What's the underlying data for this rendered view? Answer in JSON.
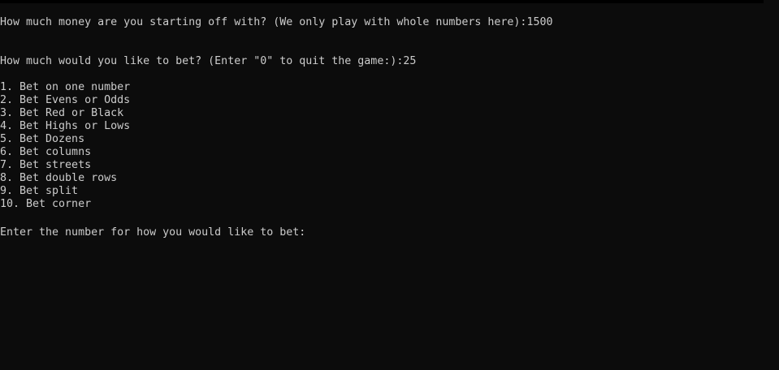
{
  "console": {
    "prompt_money": "How much money are you starting off with? (We only play with whole numbers here):",
    "input_money": "1500",
    "prompt_bet": "How much would you like to bet? (Enter \"0\" to quit the game:):",
    "input_bet": "25",
    "menu": [
      "1. Bet on one number",
      "2. Bet Evens or Odds",
      "3. Bet Red or Black",
      "4. Bet Highs or Lows",
      "5. Bet Dozens",
      "6. Bet columns",
      "7. Bet streets",
      "8. Bet double rows",
      "9. Bet split",
      "10. Bet corner"
    ],
    "prompt_choice": "Enter the number for how you would like to bet:"
  },
  "colors": {
    "background": "#0c0c0c",
    "text": "#cccccc"
  }
}
